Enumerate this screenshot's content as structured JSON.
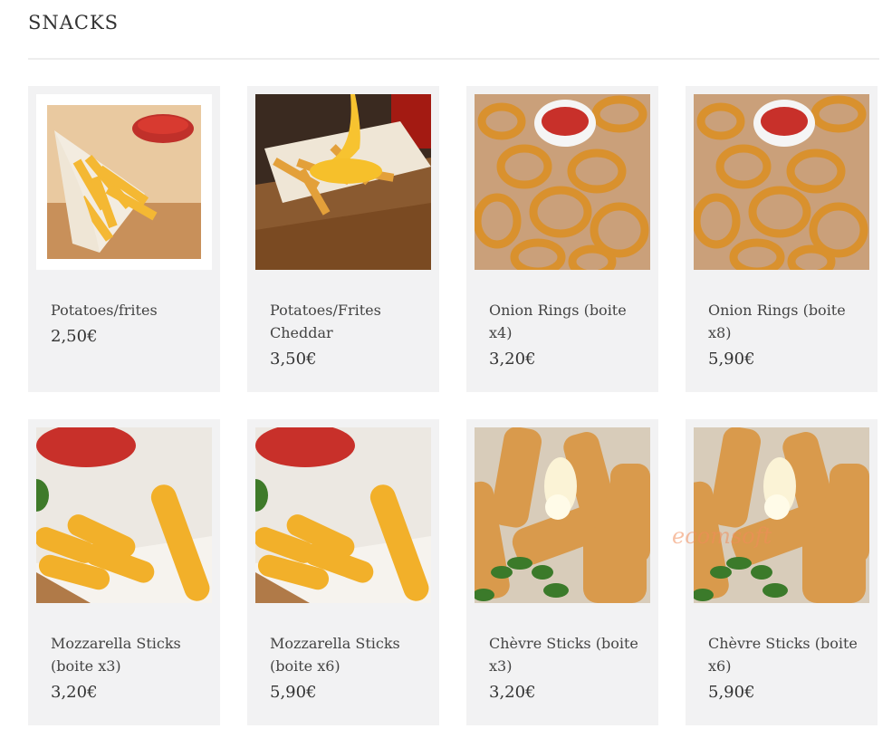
{
  "section": {
    "title": "SNACKS"
  },
  "products": [
    {
      "name": "Potatoes/frites",
      "price": "2,50€",
      "image": "fries-in-paper-cone-photo"
    },
    {
      "name": "Potatoes/Frites Cheddar",
      "price": "3,50€",
      "image": "cheddar-fries-photo"
    },
    {
      "name": "Onion Rings (boite x4)",
      "price": "3,20€",
      "image": "onion-rings-photo"
    },
    {
      "name": "Onion Rings (boite x8)",
      "price": "5,90€",
      "image": "onion-rings-photo"
    },
    {
      "name": "Mozzarella Sticks (boite x3)",
      "price": "3,20€",
      "image": "mozzarella-sticks-photo"
    },
    {
      "name": "Mozzarella Sticks (boite x6)",
      "price": "5,90€",
      "image": "mozzarella-sticks-photo"
    },
    {
      "name": "Chèvre Sticks (boite x3)",
      "price": "3,20€",
      "image": "chevre-sticks-photo"
    },
    {
      "name": "Chèvre Sticks (boite x6)",
      "price": "5,90€",
      "image": "chevre-sticks-photo"
    }
  ],
  "watermark": "ecomsoft",
  "colors": {
    "card_bg": "#f2f2f3",
    "text": "#333333",
    "rule": "#eeeeee"
  }
}
